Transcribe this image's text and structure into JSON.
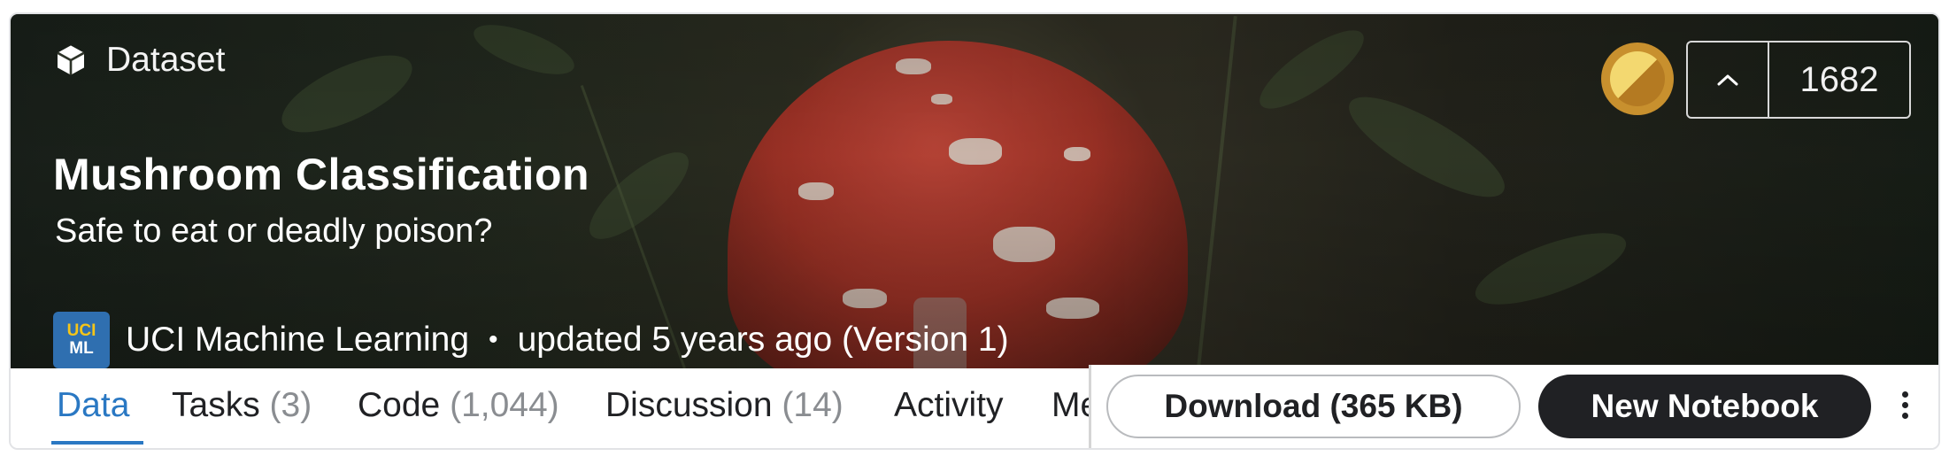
{
  "header": {
    "type_label": "Dataset",
    "title": "Mushroom Classification",
    "subtitle": "Safe to eat or deadly poison?",
    "owner": {
      "avatar_line1": "UCI",
      "avatar_line2": "ML",
      "name": "UCI Machine Learning",
      "separator": "•",
      "updated": "updated 5 years ago (Version 1)"
    },
    "vote": {
      "up_symbol": "^",
      "count": "1682"
    },
    "icons": {
      "type": "cube-icon",
      "medal": "medal-icon",
      "upvote": "chevron-up-icon"
    }
  },
  "tabs": [
    {
      "label": "Data",
      "count": "",
      "active": true
    },
    {
      "label": "Tasks",
      "count": "(3)"
    },
    {
      "label": "Code",
      "count": "(1,044)"
    },
    {
      "label": "Discussion",
      "count": "(14)"
    },
    {
      "label": "Activity",
      "count": ""
    },
    {
      "label": "Me",
      "count": ""
    }
  ],
  "actions": {
    "download_label": "Download (365 KB)",
    "new_notebook_label": "New Notebook",
    "more_icon": "more-vertical-icon"
  },
  "colors": {
    "accent": "#2a78c3",
    "primary_button": "#202124",
    "medal": "#c8902e"
  }
}
